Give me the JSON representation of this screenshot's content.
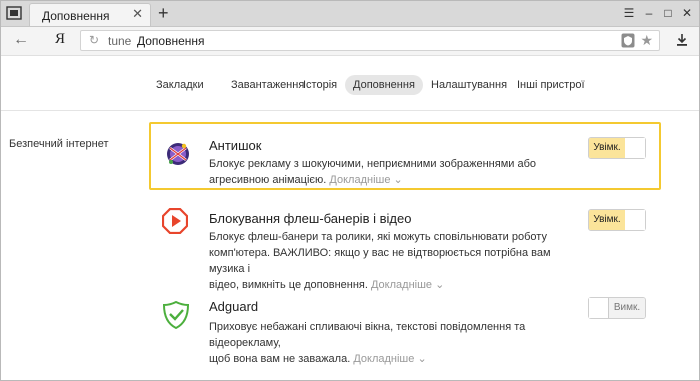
{
  "tab": {
    "title": "Доповнення",
    "close": "✕",
    "new": "+"
  },
  "window": {
    "menu": "☰",
    "minimize": "–",
    "maximize": "□",
    "close": "✕"
  },
  "toolbar": {
    "back": "←",
    "logo": "Я",
    "reload": "↻",
    "url": "tune",
    "page_title": "Доповнення",
    "star": "★"
  },
  "nav": {
    "items": [
      {
        "label": "Закладки"
      },
      {
        "label": "Завантаження"
      },
      {
        "label": "Історія"
      },
      {
        "label": "Доповнення"
      },
      {
        "label": "Налаштування"
      },
      {
        "label": "Інші пристрої"
      }
    ],
    "active_index": 3
  },
  "section": {
    "label": "Безпечний інтернет"
  },
  "extensions": [
    {
      "name": "Антишок",
      "desc_lines": [
        "Блокує рекламу з шокуючими, неприємними зображеннями або",
        "агресивною анімацією."
      ],
      "more": "Докладніше",
      "toggle": "Увімк.",
      "enabled": true,
      "highlighted": true
    },
    {
      "name": "Блокування флеш-банерів і відео",
      "desc_lines": [
        "Блокує флеш-банери та ролики, які можуть сповільнювати роботу",
        "комп'ютера. ВАЖЛИВО: якщо у вас не відтворюється потрібна вам музика і",
        "відео, вимкніть це доповнення."
      ],
      "more": "Докладніше",
      "toggle": "Увімк.",
      "enabled": true,
      "highlighted": false
    },
    {
      "name": "Adguard",
      "desc_lines": [
        "Приховує небажані спливаючі вікна, текстові повідомлення та відеорекламу,",
        "щоб вона вам не заважала."
      ],
      "more": "Докладніше",
      "toggle": "Вимк.",
      "enabled": false,
      "highlighted": false
    }
  ],
  "colors": {
    "highlight": "#f4c930",
    "toggle_on": "#fbe49a",
    "flash_icon": "#e8452c",
    "adguard_icon": "#4caf3d"
  }
}
